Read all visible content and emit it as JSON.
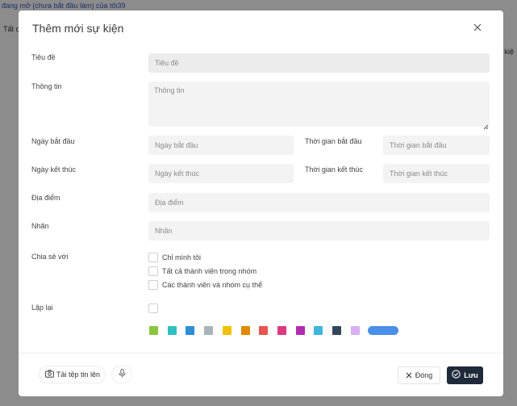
{
  "background": {
    "top_link": "đang mở (chưa bắt đầu làm) của tôi39",
    "left_text": "Tất c",
    "right_text": "ự kiệ"
  },
  "modal": {
    "title": "Thêm mới sự kiện",
    "fields": {
      "title": {
        "label": "Tiêu đề",
        "placeholder": "Tiêu đề"
      },
      "info": {
        "label": "Thông tin",
        "placeholder": "Thông tin"
      },
      "start_date": {
        "label": "Ngày bắt đầu",
        "placeholder": "Ngày bắt đầu"
      },
      "start_time": {
        "label": "Thời gian bắt đầu",
        "placeholder": "Thời gian bắt đầu"
      },
      "end_date": {
        "label": "Ngày kết thúc",
        "placeholder": "Ngày kết thúc"
      },
      "end_time": {
        "label": "Thời gian kết thúc",
        "placeholder": "Thời gian kết thúc"
      },
      "location": {
        "label": "Địa điểm",
        "placeholder": "Địa điểm"
      },
      "tag": {
        "label": "Nhãn",
        "placeholder": "Nhãn"
      }
    },
    "share": {
      "label": "Chia sẻ với",
      "options": [
        "Chỉ mình tôi",
        "Tất cả thành viên trong nhóm",
        "Các thành viên và nhóm cụ thể"
      ]
    },
    "repeat": {
      "label": "Lặp lại"
    },
    "colors": [
      "#8cc63f",
      "#2fc1bf",
      "#2b8fd6",
      "#a9b4bb",
      "#f2c200",
      "#e08a00",
      "#e8554e",
      "#d93a80",
      "#b22cb0",
      "#3fb6de",
      "#34465a",
      "#d8b0f5",
      "#4a8fe8"
    ],
    "footer": {
      "upload_label": "Tải tệp tin lên",
      "close_label": "Đóng",
      "save_label": "Lưu"
    }
  }
}
